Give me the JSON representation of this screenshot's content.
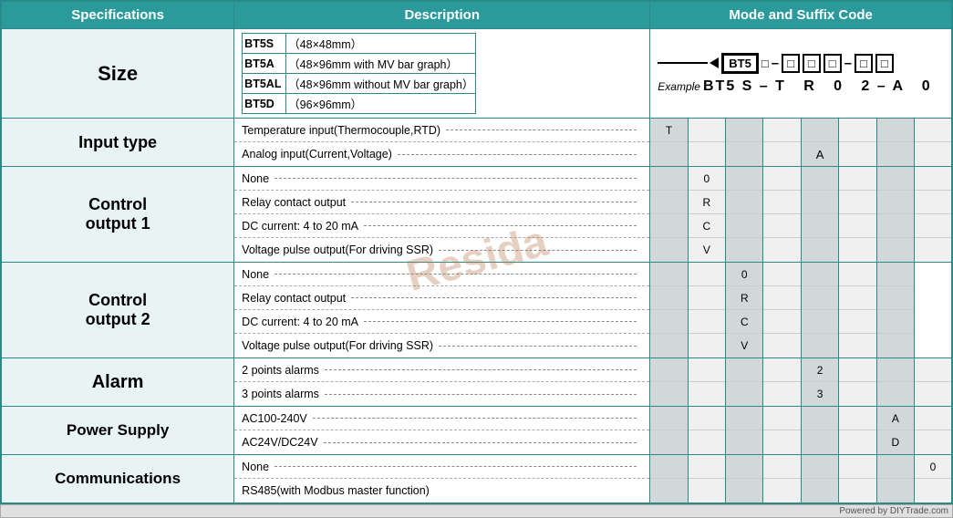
{
  "header": {
    "specs": "Specifications",
    "description": "Description",
    "mode": "Mode and Suffix Code"
  },
  "size": {
    "label": "Size",
    "models": [
      {
        "name": "BT5S",
        "dim": "（48×48mm）"
      },
      {
        "name": "BT5A",
        "dim": "（48×96mm  with MV bar graph）"
      },
      {
        "name": "BT5AL",
        "dim": "（48×96mm  without MV bar graph）"
      },
      {
        "name": "BT5D",
        "dim": "（96×96mm）"
      }
    ],
    "arrow_label": "←",
    "diagram_codes": [
      "BT5",
      "□",
      "–",
      "□",
      "□",
      "□",
      "–",
      "□",
      "□"
    ],
    "example_label": "Example",
    "example": "BT5 S – T    R    0   2 – A    0"
  },
  "input_type": {
    "label": "Input type",
    "options": [
      {
        "text": "Temperature input(Thermocouple,RTD)",
        "code": "T"
      },
      {
        "text": "Analog input(Current,Voltage)",
        "code": "A"
      }
    ]
  },
  "control_output1": {
    "label": "Control\noutput 1",
    "options": [
      {
        "text": "None",
        "code": "0"
      },
      {
        "text": "Relay contact output",
        "code": "R"
      },
      {
        "text": "DC current: 4 to 20 mA",
        "code": "C"
      },
      {
        "text": "Voltage pulse output(For driving SSR)",
        "code": "V"
      }
    ]
  },
  "control_output2": {
    "label": "Control\noutput 2",
    "options": [
      {
        "text": "None",
        "code": "0"
      },
      {
        "text": "Relay contact output",
        "code": "R"
      },
      {
        "text": "DC current: 4 to 20 mA",
        "code": "C"
      },
      {
        "text": "Voltage pulse output(For driving SSR)",
        "code": "V"
      }
    ]
  },
  "alarm": {
    "label": "Alarm",
    "options": [
      {
        "text": "2 points alarms",
        "code": "2"
      },
      {
        "text": "3 points alarms",
        "code": "3"
      }
    ]
  },
  "power_supply": {
    "label": "Power Supply",
    "options": [
      {
        "text": "AC100-240V",
        "code": "A"
      },
      {
        "text": "AC24V/DC24V",
        "code": "D"
      }
    ]
  },
  "communications": {
    "label": "Communications",
    "options": [
      {
        "text": "None",
        "code": "0"
      },
      {
        "text": "RS485(with Modbus master function)",
        "code": ""
      }
    ]
  },
  "watermark": "Resida",
  "footer": "Powered by DIYTrade.com"
}
